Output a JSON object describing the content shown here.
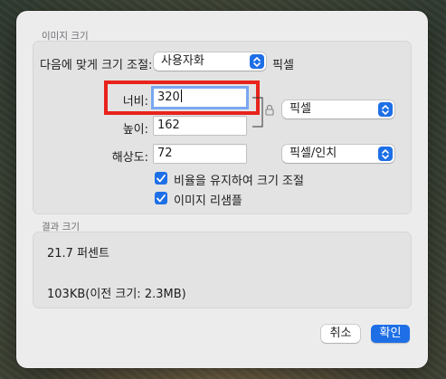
{
  "dialog": {
    "image_size_header": "이미지 크기",
    "fit_label": "다음에 맞게 크기 조절:",
    "fit_value": "사용자화",
    "fit_unit": "픽셀",
    "width_label": "너비:",
    "width_value": "320",
    "height_label": "높이:",
    "height_value": "162",
    "dimension_unit": "픽셀",
    "resolution_label": "해상도:",
    "resolution_value": "72",
    "resolution_unit": "픽셀/인치",
    "scale_proportionally_label": "비율을 유지하여 크기 조절",
    "scale_proportionally_checked": true,
    "resample_label": "이미지 리샘플",
    "resample_checked": true,
    "result_header": "결과 크기",
    "result_percent": "21.7 퍼센트",
    "result_size": "103KB(이전 크기: 2.3MB)",
    "cancel_label": "취소",
    "ok_label": "확인"
  },
  "colors": {
    "accent": "#1e6fe6",
    "highlight_red": "#e8231b",
    "dialog_bg": "#ececec",
    "group_bg": "#e3e3e3"
  },
  "icons": {
    "popup": "chevron-up-down-icon",
    "lock": "lock-icon",
    "checkbox": "checkmark-icon"
  }
}
